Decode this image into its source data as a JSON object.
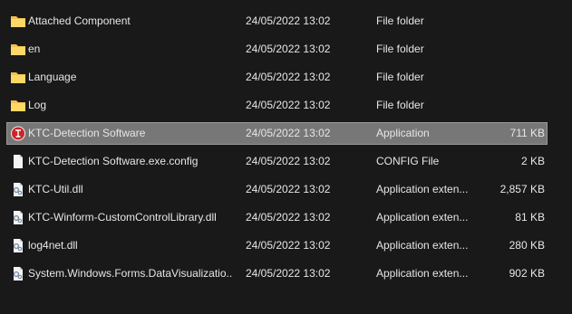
{
  "files": [
    {
      "name": "Attached Component",
      "date": "24/05/2022 13:02",
      "type": "File folder",
      "size": "",
      "icon": "folder-icon"
    },
    {
      "name": "en",
      "date": "24/05/2022 13:02",
      "type": "File folder",
      "size": "",
      "icon": "folder-icon"
    },
    {
      "name": "Language",
      "date": "24/05/2022 13:02",
      "type": "File folder",
      "size": "",
      "icon": "folder-icon"
    },
    {
      "name": "Log",
      "date": "24/05/2022 13:02",
      "type": "File folder",
      "size": "",
      "icon": "folder-icon"
    },
    {
      "name": "KTC-Detection Software",
      "date": "24/05/2022 13:02",
      "type": "Application",
      "size": "711 KB",
      "icon": "app-icon",
      "selected": true
    },
    {
      "name": "KTC-Detection Software.exe.config",
      "date": "24/05/2022 13:02",
      "type": "CONFIG File",
      "size": "2 KB",
      "icon": "file-icon"
    },
    {
      "name": "KTC-Util.dll",
      "date": "24/05/2022 13:02",
      "type": "Application exten...",
      "size": "2,857 KB",
      "icon": "dll-icon"
    },
    {
      "name": "KTC-Winform-CustomControlLibrary.dll",
      "date": "24/05/2022 13:02",
      "type": "Application exten...",
      "size": "81 KB",
      "icon": "dll-icon"
    },
    {
      "name": "log4net.dll",
      "date": "24/05/2022 13:02",
      "type": "Application exten...",
      "size": "280 KB",
      "icon": "dll-icon"
    },
    {
      "name": "System.Windows.Forms.DataVisualizatio...",
      "date": "24/05/2022 13:02",
      "type": "Application exten...",
      "size": "902 KB",
      "icon": "dll-icon"
    }
  ],
  "colors": {
    "background": "#191919",
    "selection": "#777777",
    "folder": "#f2c14e",
    "app_icon": "#c8262a"
  }
}
